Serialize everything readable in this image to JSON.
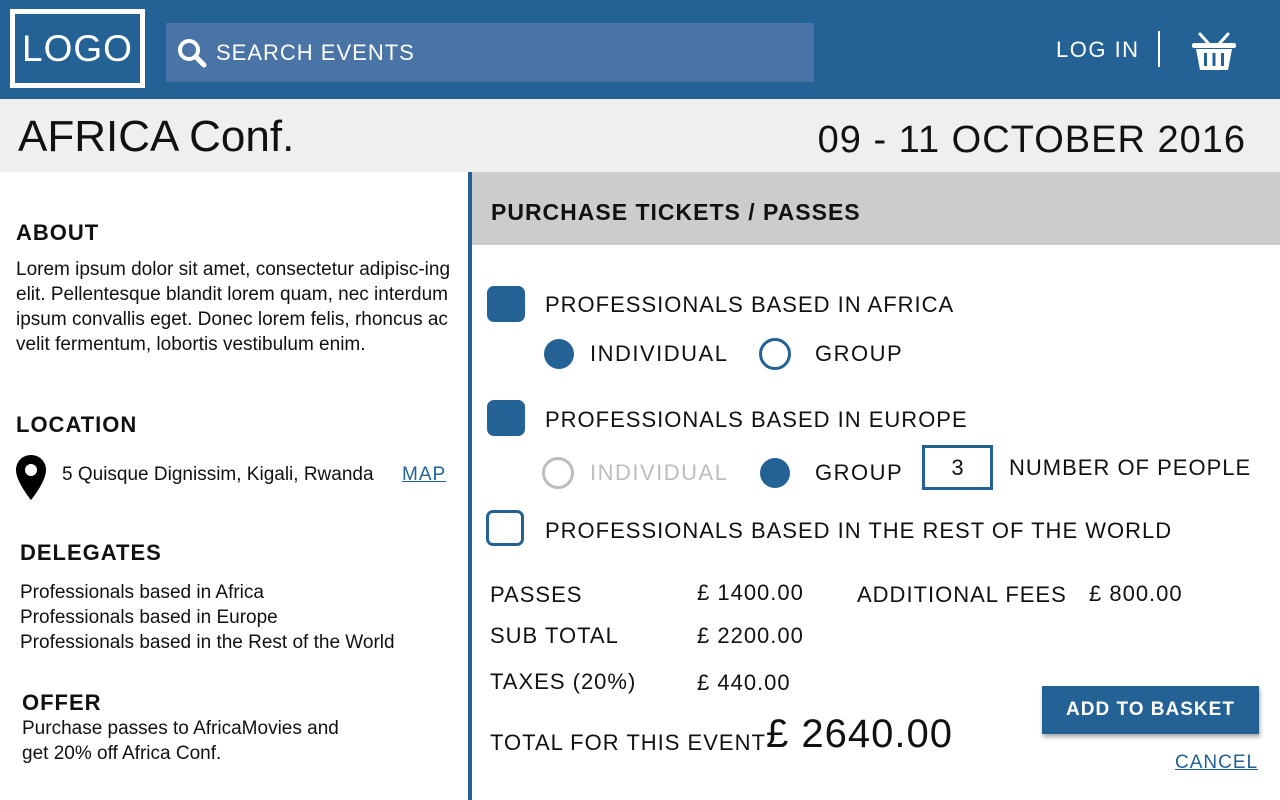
{
  "header": {
    "logo": "LOGO",
    "search_placeholder": "SEARCH EVENTS",
    "login_label": "LOG IN",
    "icons": [
      "search-icon",
      "basket-icon"
    ]
  },
  "event": {
    "title": "AFRICA Conf.",
    "date": "09 - 11 OCTOBER 2016"
  },
  "sidebar": {
    "about_heading": "ABOUT",
    "about_text": "Lorem ipsum dolor sit amet, consectetur adipisc-ing elit. Pellentesque blandit lorem quam, nec interdum ipsum convallis eget. Donec lorem felis, rhoncus ac velit fermentum, lobortis vestibulum enim.",
    "location_heading": "LOCATION",
    "address": "5 Quisque Dignissim, Kigali, Rwanda",
    "map_link": "MAP",
    "delegates_heading": "DELEGATES",
    "delegates": [
      "Professionals based in Africa",
      "Professionals based in Europe",
      "Professionals based in the Rest of the World"
    ],
    "offer_heading": "OFFER",
    "offer_line1": "Purchase passes to AfricaMovies and",
    "offer_line2": "get 20% off  Africa Conf."
  },
  "purchase": {
    "heading": "PURCHASE TICKETS / PASSES",
    "options": [
      {
        "label": "PROFESSIONALS BASED IN AFRICA",
        "checked": true,
        "individual_label": "INDIVIDUAL",
        "group_label": "GROUP",
        "selected": "individual"
      },
      {
        "label": "PROFESSIONALS BASED IN EUROPE",
        "checked": true,
        "individual_label": "INDIVIDUAL",
        "group_label": "GROUP",
        "selected": "group",
        "people_count": "3",
        "people_label": "NUMBER OF PEOPLE"
      },
      {
        "label": "PROFESSIONALS BASED IN THE REST OF THE WORLD",
        "checked": false
      }
    ],
    "summary": {
      "passes_label": "PASSES",
      "passes_value": "£ 1400.00",
      "fees_label": "ADDITIONAL FEES",
      "fees_value": "£ 800.00",
      "subtotal_label": "SUB TOTAL",
      "subtotal_value": "£ 2200.00",
      "taxes_label": "TAXES (20%)",
      "taxes_value": "£ 440.00",
      "total_label": "TOTAL FOR THIS EVENT",
      "total_value": "£ 2640.00"
    },
    "add_button": "ADD TO BASKET",
    "cancel_link": "CANCEL"
  },
  "colors": {
    "brand": "#246295",
    "search_bg": "#4a74a5",
    "title_bar_bg": "#efefed",
    "panel_head_bg": "#cccccc",
    "disabled": "#bdbdbd"
  }
}
